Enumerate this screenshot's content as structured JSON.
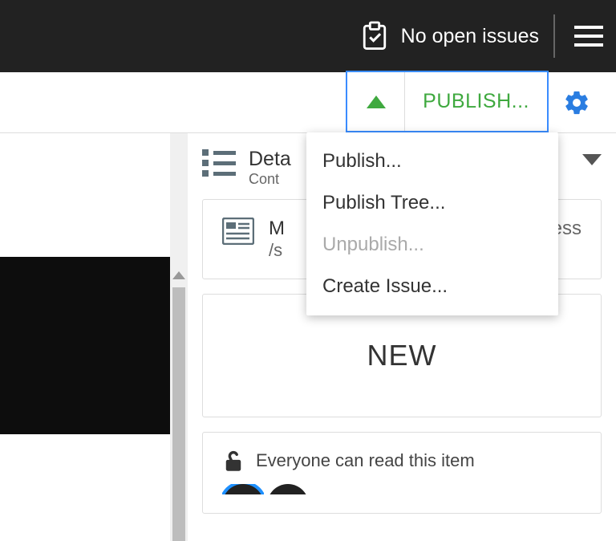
{
  "topbar": {
    "issues_text": "No open issues"
  },
  "actionbar": {
    "publish_label": "PUBLISH..."
  },
  "details": {
    "title": "Deta",
    "subtitle": "Cont"
  },
  "media_card": {
    "title": "M",
    "path": "/s",
    "right_suffix": "ess"
  },
  "status_card": {
    "label": "NEW"
  },
  "permissions": {
    "text": "Everyone can read this item"
  },
  "publish_menu": {
    "items": [
      {
        "label": "Publish...",
        "disabled": false
      },
      {
        "label": "Publish Tree...",
        "disabled": false
      },
      {
        "label": "Unpublish...",
        "disabled": true
      },
      {
        "label": "Create Issue...",
        "disabled": false
      }
    ]
  }
}
